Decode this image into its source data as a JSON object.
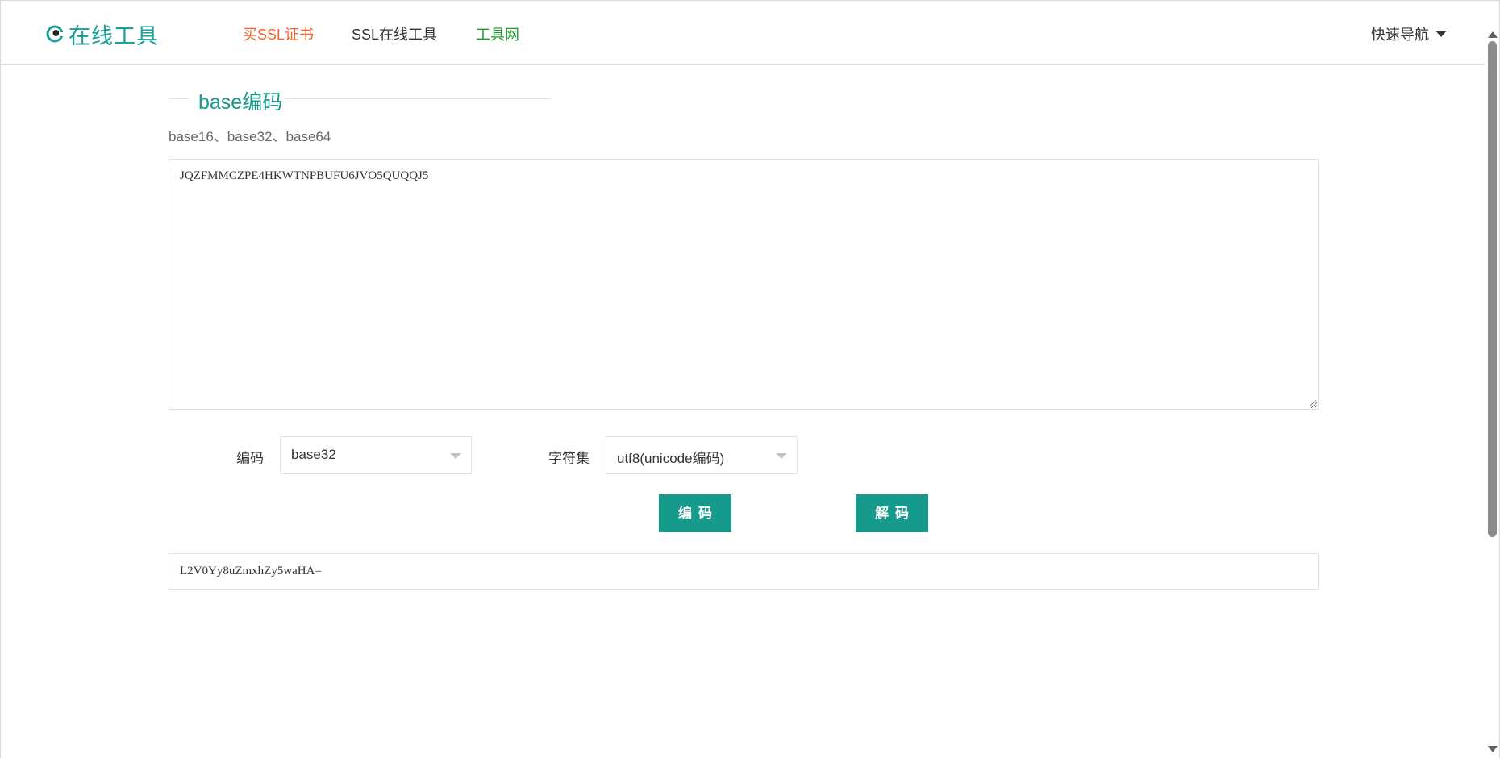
{
  "header": {
    "logo_text": "在线工具",
    "nav": {
      "buy_ssl": "买SSL证书",
      "ssl_tools": "SSL在线工具",
      "tools_net": "工具网"
    },
    "quick_nav": "快速导航"
  },
  "section": {
    "title": "base编码",
    "subtitle": "base16、base32、base64"
  },
  "input": {
    "value": "JQZFMMCZPE4HKWTNPBUFU6JVO5QUQQJ5"
  },
  "controls": {
    "encoding_label": "编码",
    "encoding_value": "base32",
    "charset_label": "字符集",
    "charset_value": "utf8(unicode编码)"
  },
  "buttons": {
    "encode": "编码",
    "decode": "解码"
  },
  "output": {
    "value": "L2V0Yy8uZmxhZy5waHA="
  },
  "colors": {
    "brand": "#159a8c",
    "buy_ssl": "#f0642b",
    "tools_net": "#1c9a2a"
  },
  "icons": {
    "logo": "eye-logo-icon",
    "quick_nav": "caret-down-icon",
    "select": "chevron-down-icon",
    "resize": "resize-grip-icon"
  }
}
